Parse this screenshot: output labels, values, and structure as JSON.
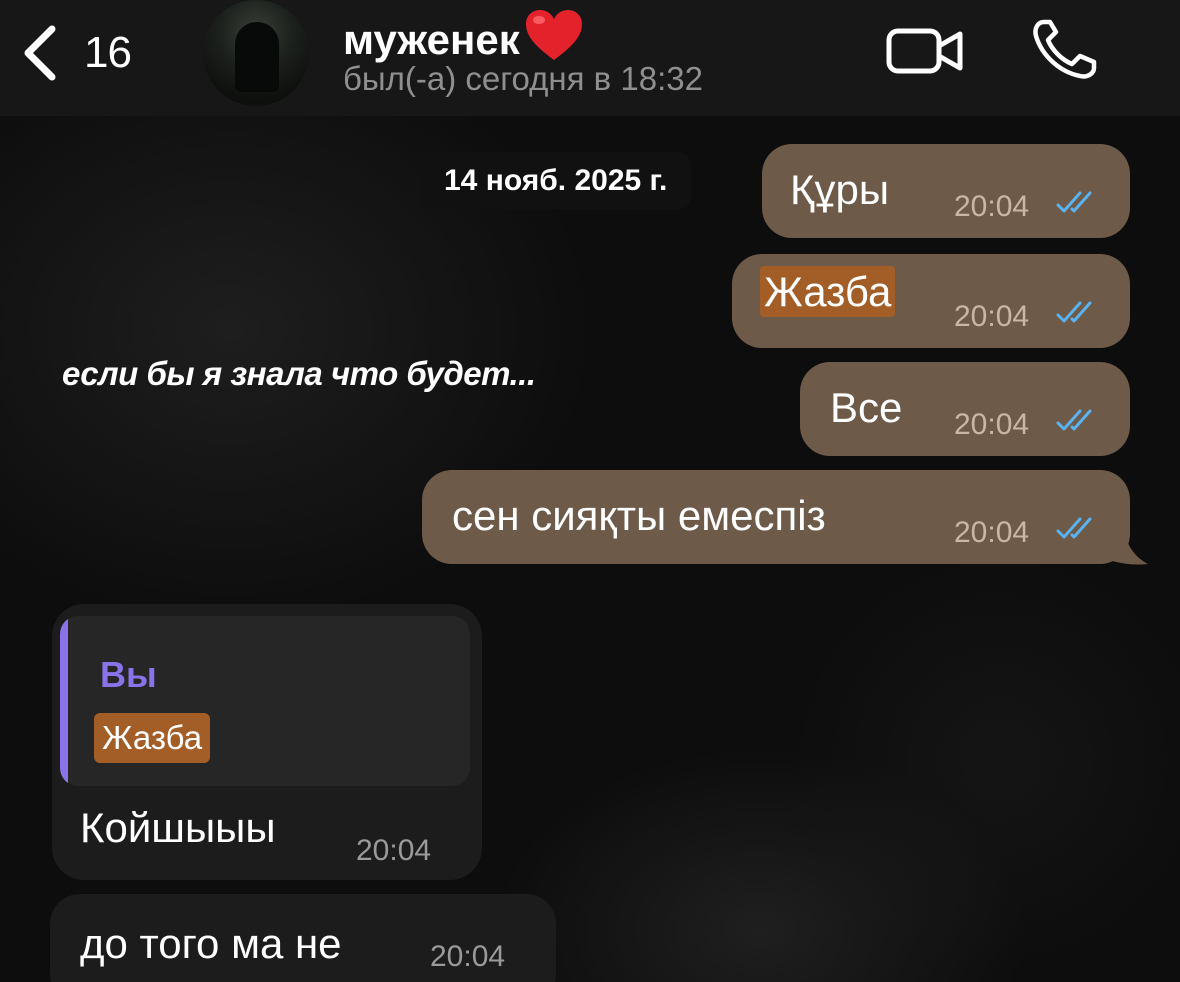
{
  "header": {
    "back_count": "16",
    "contact_name": "муженек",
    "contact_status": "был(-а) сегодня в 18:32",
    "icons": [
      "chevron-left-icon",
      "avatar",
      "heart-icon",
      "video-icon",
      "phone-icon"
    ]
  },
  "date_chip": "14 нояб. 2025 г.",
  "overlay_caption": "если бы я знала что будет...",
  "outgoing_messages": [
    {
      "text": "Құры",
      "time": "20:04",
      "status": "read"
    },
    {
      "text": "Жазба",
      "time": "20:04",
      "status": "read"
    },
    {
      "text": "Все",
      "time": "20:04",
      "status": "read"
    },
    {
      "text": "сен сияқты емеспіз",
      "time": "20:04",
      "status": "read"
    }
  ],
  "incoming_messages": [
    {
      "reply_to": {
        "author": "Вы",
        "text": "Жазба"
      },
      "text": "Койшыыы",
      "time": "20:04"
    },
    {
      "text": "до того ма не",
      "time": "20:04"
    }
  ],
  "colors": {
    "outgoing_bubble": "#6e5a49",
    "incoming_bubble": "#1c1c1c",
    "read_ticks": "#5ab3f0",
    "reply_accent": "#8a72e8",
    "highlight": "#a35e27"
  }
}
